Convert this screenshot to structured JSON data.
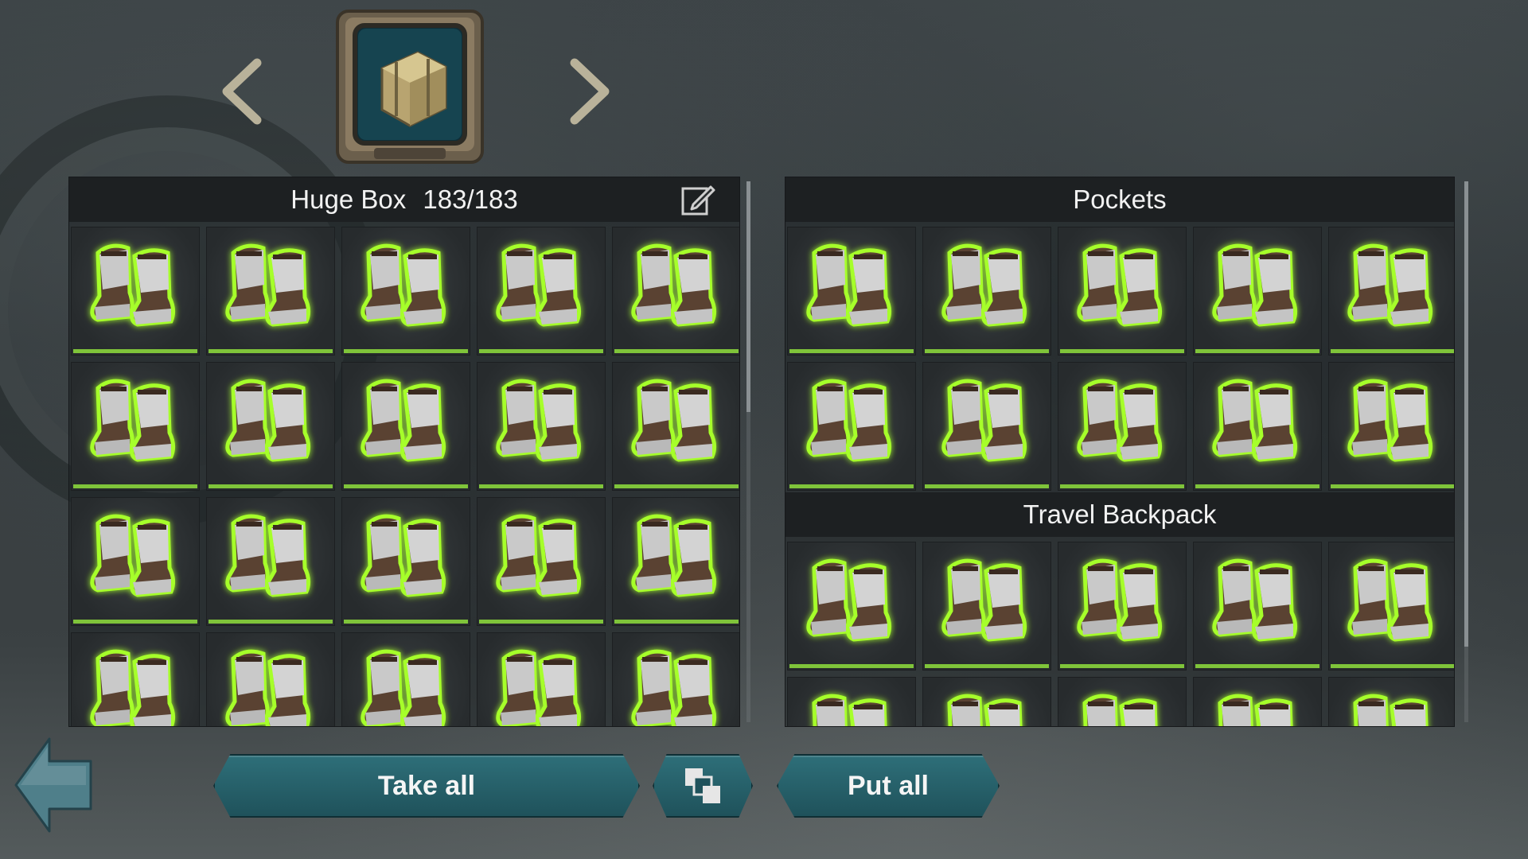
{
  "colors": {
    "accent": "#7fc43a",
    "button": "#2e6f79",
    "panel_header": "#1c2022"
  },
  "icons": {
    "prev": "chevron-left-icon",
    "next": "chevron-right-icon",
    "container": "crate-icon",
    "edit": "edit-icon",
    "item": "boots-icon",
    "back": "back-arrow-icon",
    "stack": "stack-icon"
  },
  "left_panel": {
    "name": "Huge Box",
    "capacity": "183/183",
    "item_name": "Boots",
    "visible_slots": 20
  },
  "right_panel": {
    "pockets": {
      "title": "Pockets",
      "visible_slots": 10
    },
    "backpack": {
      "title": "Travel Backpack",
      "visible_slots": 10
    }
  },
  "buttons": {
    "take_all": "Take all",
    "put_all": "Put all"
  }
}
